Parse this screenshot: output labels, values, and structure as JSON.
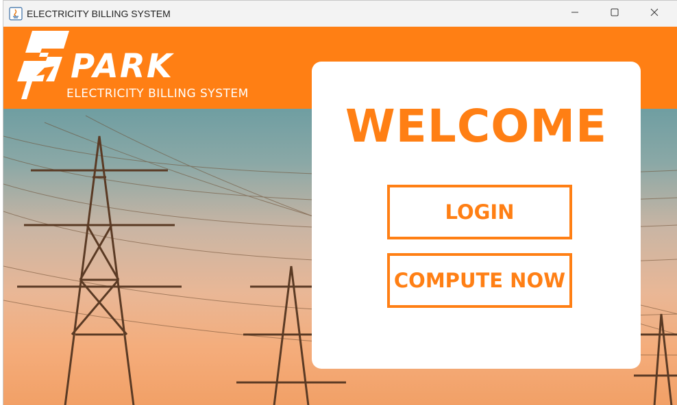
{
  "window": {
    "title": "ELECTRICITY BILLING SYSTEM",
    "icons": [
      "java-app-icon",
      "minimize-icon",
      "maximize-icon",
      "close-icon"
    ]
  },
  "brand": {
    "name": "PARK",
    "subtitle": "ELECTRICITY BILLING SYSTEM",
    "accent_color": "#ff7f14"
  },
  "welcome_card": {
    "heading": "WELCOME",
    "login_label": "LOGIN",
    "compute_label": "COMPUTE NOW"
  }
}
